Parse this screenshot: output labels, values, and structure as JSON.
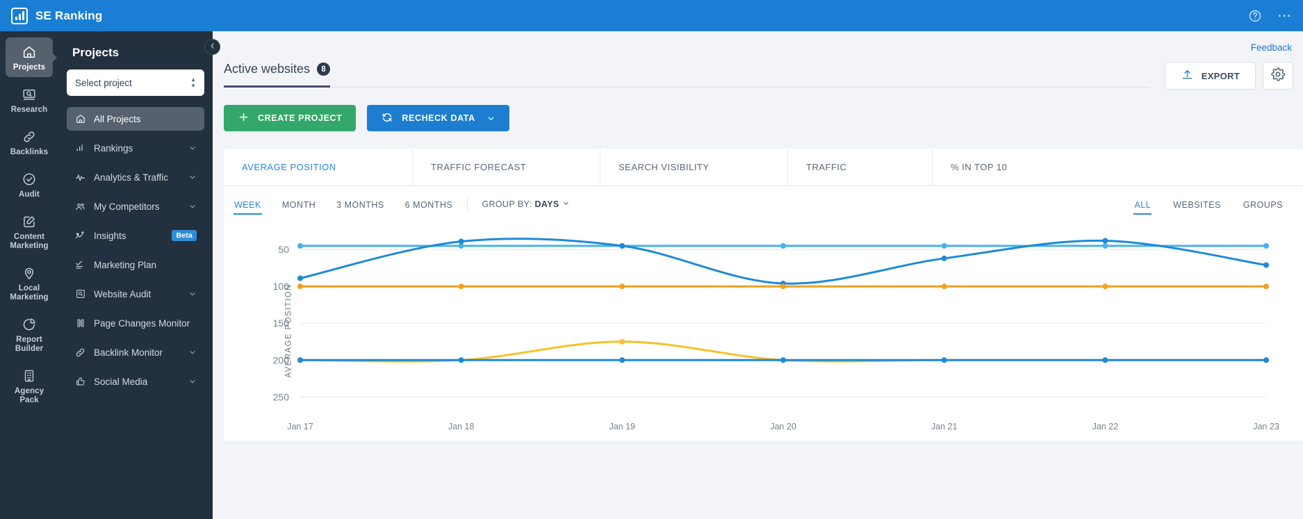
{
  "topbar": {
    "brand": "SE Ranking",
    "help_icon": "help-circle-icon",
    "more_icon": "more-horizontal-icon",
    "more_glyph": "⋯"
  },
  "rail": {
    "items": [
      {
        "label": "Projects",
        "icon": "home-icon",
        "active": true
      },
      {
        "label": "Research",
        "icon": "magnifier-screen-icon",
        "active": false
      },
      {
        "label": "Backlinks",
        "icon": "link-icon",
        "active": false
      },
      {
        "label": "Audit",
        "icon": "check-circle-icon",
        "active": false
      },
      {
        "label": "Content\nMarketing",
        "line1": "Content",
        "line2": "Marketing",
        "icon": "pencil-square-icon",
        "active": false
      },
      {
        "label": "Local\nMarketing",
        "line1": "Local",
        "line2": "Marketing",
        "icon": "map-pin-icon",
        "active": false
      },
      {
        "label": "Report\nBuilder",
        "line1": "Report",
        "line2": "Builder",
        "icon": "pie-chart-icon",
        "active": false
      },
      {
        "label": "Agency\nPack",
        "line1": "Agency",
        "line2": "Pack",
        "icon": "building-icon",
        "active": false
      }
    ]
  },
  "panel": {
    "title": "Projects",
    "collapse_icon": "chevron-left-icon",
    "project_select": {
      "value": "Select project",
      "icon": "stepper-updown-icon"
    },
    "menu": [
      {
        "label": "All Projects",
        "icon": "home-icon",
        "active": true,
        "chevron": false
      },
      {
        "label": "Rankings",
        "icon": "bar-chart-icon",
        "active": false,
        "chevron": true
      },
      {
        "label": "Analytics & Traffic",
        "icon": "pulse-icon",
        "active": false,
        "chevron": true
      },
      {
        "label": "My Competitors",
        "icon": "users-icon",
        "active": false,
        "chevron": true
      },
      {
        "label": "Insights",
        "icon": "sparkline-icon",
        "active": false,
        "chevron": false,
        "badge": "Beta"
      },
      {
        "label": "Marketing Plan",
        "icon": "checklist-icon",
        "active": false,
        "chevron": false
      },
      {
        "label": "Website Audit",
        "icon": "magnifier-screen-icon",
        "active": false,
        "chevron": true
      },
      {
        "label": "Page Changes Monitor",
        "icon": "book-open-icon",
        "active": false,
        "chevron": false
      },
      {
        "label": "Backlink Monitor",
        "icon": "link-icon",
        "active": false,
        "chevron": true
      },
      {
        "label": "Social Media",
        "icon": "thumbs-up-icon",
        "active": false,
        "chevron": true
      }
    ]
  },
  "main": {
    "feedback": "Feedback",
    "page_tab": {
      "label": "Active websites",
      "count": "8"
    },
    "export_button": {
      "label": "EXPORT",
      "icon": "upload-icon"
    },
    "settings_button": {
      "icon": "gear-icon"
    },
    "create_project_button": {
      "label": "CREATE PROJECT",
      "icon": "plus-icon"
    },
    "recheck_button": {
      "label": "RECHECK DATA",
      "icon": "refresh-icon",
      "caret": "chevron-down-icon"
    },
    "metric_tabs": [
      {
        "label": "AVERAGE POSITION",
        "active": true
      },
      {
        "label": "TRAFFIC FORECAST",
        "active": false
      },
      {
        "label": "SEARCH VISIBILITY",
        "active": false
      },
      {
        "label": "TRAFFIC",
        "active": false
      },
      {
        "label": "% IN TOP 10",
        "active": false
      }
    ],
    "periods": [
      {
        "label": "WEEK",
        "active": true
      },
      {
        "label": "MONTH",
        "active": false
      },
      {
        "label": "3 MONTHS",
        "active": false
      },
      {
        "label": "6 MONTHS",
        "active": false
      }
    ],
    "group_by": {
      "prefix": "GROUP BY:",
      "value": "DAYS",
      "caret": "chevron-down-icon"
    },
    "scopes": [
      {
        "label": "ALL",
        "active": true
      },
      {
        "label": "WEBSITES",
        "active": false
      },
      {
        "label": "GROUPS",
        "active": false
      }
    ]
  },
  "chart_data": {
    "type": "line",
    "title": "",
    "xlabel": "",
    "ylabel": "AVERAGE POSITION",
    "x": [
      "Jan 17",
      "Jan 18",
      "Jan 19",
      "Jan 20",
      "Jan 21",
      "Jan 22",
      "Jan 23"
    ],
    "yticks": [
      50,
      100,
      150,
      200,
      250
    ],
    "ylim": [
      30,
      262
    ],
    "y_inverted": true,
    "grid": true,
    "legend": "none",
    "series": [
      {
        "name": "series-light-blue-top",
        "color": "#49b2e8",
        "values": [
          45,
          45,
          45,
          45,
          45,
          45,
          45
        ]
      },
      {
        "name": "series-blue-curve",
        "color": "#1d8ad6",
        "values": [
          89,
          39,
          45,
          96,
          62,
          38,
          71
        ]
      },
      {
        "name": "series-orange-flat",
        "color": "#f2a01e",
        "values": [
          100,
          100,
          100,
          100,
          100,
          100,
          100
        ]
      },
      {
        "name": "series-yellow-curve",
        "color": "#f4c328",
        "values": [
          200,
          200,
          175,
          200,
          200,
          200,
          200
        ]
      },
      {
        "name": "series-blue-flat",
        "color": "#1d8ad6",
        "values": [
          200,
          200,
          200,
          200,
          200,
          200,
          200
        ]
      }
    ]
  }
}
